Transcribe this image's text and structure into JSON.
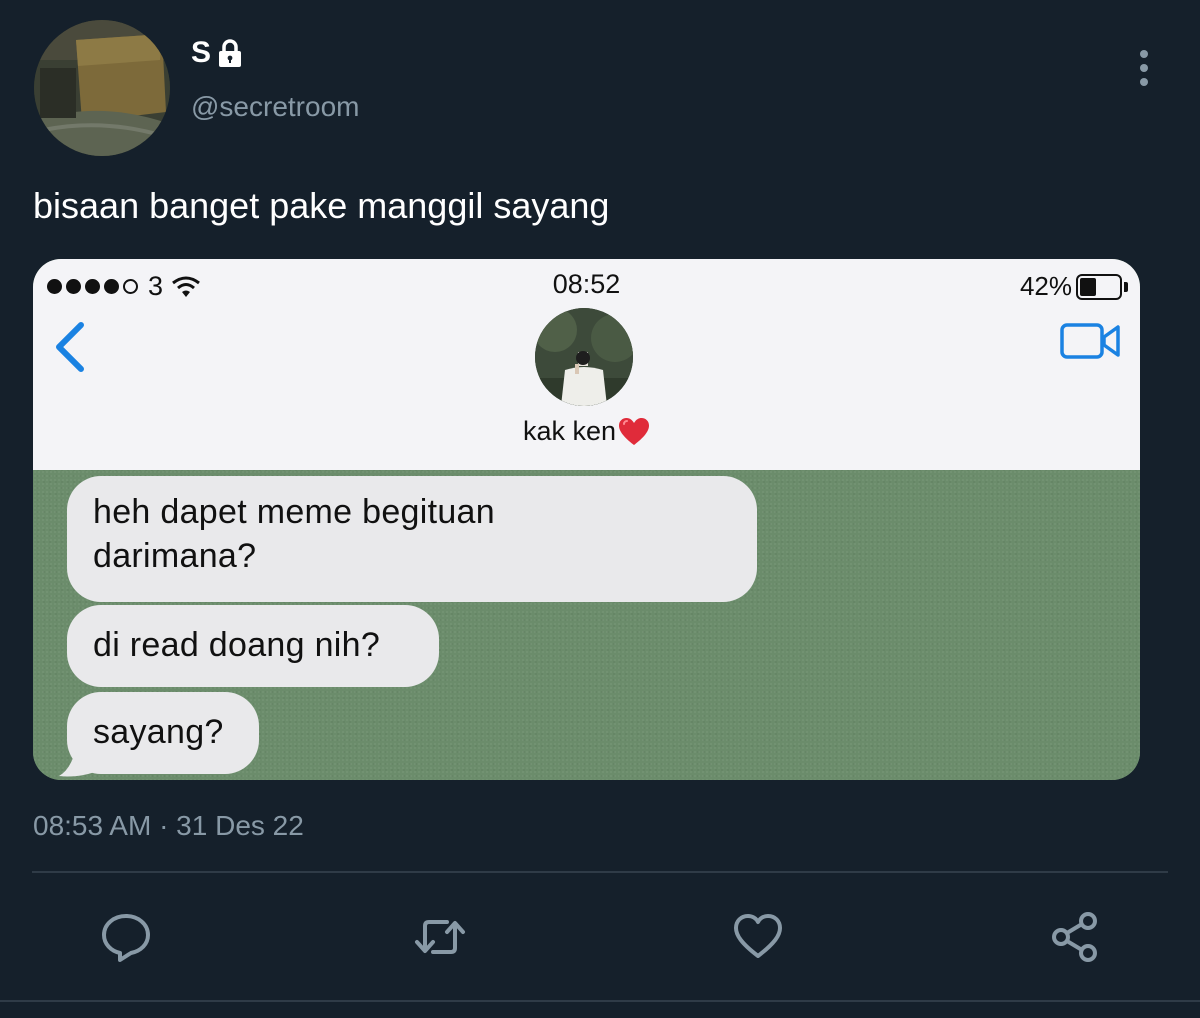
{
  "tweet": {
    "display_name": "S",
    "handle": "@secretroom",
    "text": "bisaan banget pake manggil sayang",
    "timestamp": "08:53 AM · 31 Des 22"
  },
  "icons": {
    "verified_lock": "lock-icon",
    "more": "more-vertical-icon",
    "reply": "reply-icon",
    "retweet": "retweet-icon",
    "like": "heart-icon",
    "share": "share-icon"
  },
  "media": {
    "status_bar": {
      "carrier": "3",
      "time": "08:52",
      "battery": "42%",
      "battery_level": 0.42
    },
    "contact": {
      "name": "kak ken"
    },
    "messages": [
      {
        "line1": "heh dapet meme begituan",
        "line2": "darimana?"
      },
      {
        "line1": "di read doang nih?"
      },
      {
        "line1": "sayang?"
      }
    ]
  },
  "colors": {
    "background": "#15202b",
    "secondary_text": "#8899a6",
    "ios_blue": "#1a82e2",
    "chat_background": "#6b8c6b",
    "bubble": "#e9e9eb",
    "heart": "#e02b3a"
  }
}
